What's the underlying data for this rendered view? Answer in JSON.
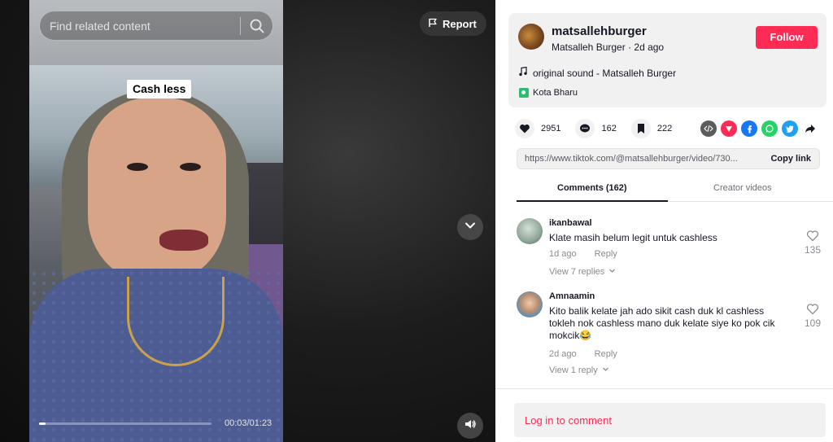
{
  "search": {
    "placeholder": "Find related content"
  },
  "video": {
    "report_label": "Report",
    "caption_overlay": "Cash less",
    "time": "00:03/01:23",
    "progress": 0.036
  },
  "author": {
    "username": "matsallehburger",
    "nickname": "Matsalleh Burger",
    "posted": "2d ago",
    "follow_label": "Follow",
    "music": "original sound - Matsalleh Burger",
    "location": "Kota Bharu"
  },
  "stats": {
    "likes": "2951",
    "comments": "162",
    "saves": "222"
  },
  "share_icons": [
    "embed-icon",
    "send-icon",
    "facebook-icon",
    "whatsapp-icon",
    "twitter-icon",
    "forward-icon"
  ],
  "link": {
    "url": "https://www.tiktok.com/@matsallehburger/video/730...",
    "copy_label": "Copy link"
  },
  "tabs": [
    {
      "label": "Comments (162)",
      "active": true
    },
    {
      "label": "Creator videos",
      "active": false
    }
  ],
  "comments": [
    {
      "user": "ikanbawal",
      "text": "Klate masih belum legit untuk cashless",
      "time": "1d ago",
      "reply_label": "Reply",
      "likes": "135",
      "view_replies": "View 7 replies"
    },
    {
      "user": "Amnaamin",
      "text": "Kito balik kelate jah ado sikit cash duk kl cashless tokleh nok cashless mano duk kelate siye ko pok cik mokcik😂",
      "time": "2d ago",
      "reply_label": "Reply",
      "likes": "109",
      "view_replies": "View 1 reply"
    }
  ],
  "login_prompt": "Log in to comment",
  "colors": {
    "accent": "#fe2c55",
    "panel_bg": "#f1f1f2",
    "text_primary": "#161823",
    "text_secondary": "#8a8b91"
  }
}
